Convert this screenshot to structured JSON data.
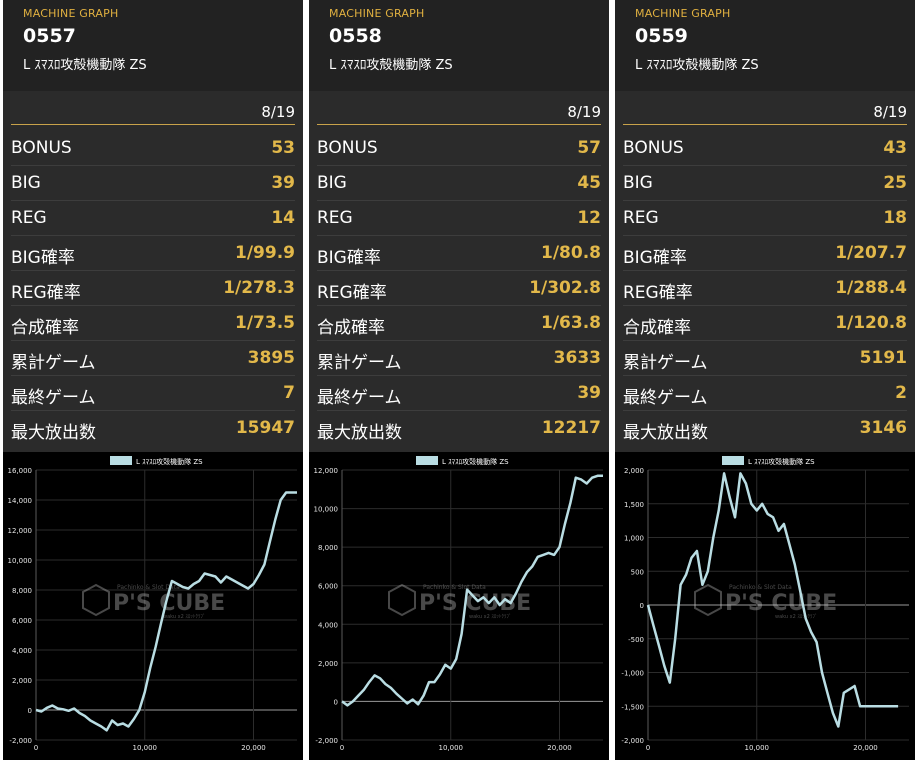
{
  "panels": [
    {
      "label": "MACHINE GRAPH",
      "number": "0557",
      "machine": "L ｽﾏｽﾛ攻殻機動隊 ZS",
      "date": "8/19",
      "stats": [
        {
          "key": "BONUS",
          "value": "53"
        },
        {
          "key": "BIG",
          "value": "39"
        },
        {
          "key": "REG",
          "value": "14"
        },
        {
          "key": "BIG確率",
          "value": "1/99.9"
        },
        {
          "key": "REG確率",
          "value": "1/278.3"
        },
        {
          "key": "合成確率",
          "value": "1/73.5"
        },
        {
          "key": "累計ゲーム",
          "value": "3895"
        },
        {
          "key": "最終ゲーム",
          "value": "7"
        },
        {
          "key": "最大放出数",
          "value": "15947"
        }
      ],
      "chart_data": {
        "type": "line",
        "series": [
          {
            "name": "L ｽﾏｽﾛ攻殻機動隊 ZS",
            "color": "#b9dde3"
          }
        ],
        "ylim": [
          -2000,
          16000
        ],
        "xlim": [
          0,
          24000
        ],
        "yticks": [
          -2000,
          0,
          2000,
          4000,
          6000,
          8000,
          10000,
          12000,
          14000,
          16000
        ],
        "ytick_labels": [
          "-2,000",
          "0",
          "2,000",
          "4,000",
          "6,000",
          "8,000",
          "10,000",
          "12,000",
          "14,000",
          "16,000"
        ],
        "xticks": [
          0,
          10000,
          20000
        ],
        "xtick_labels": [
          "0",
          "10,000",
          "20,000"
        ],
        "x": [
          0,
          500,
          1000,
          1500,
          2000,
          2500,
          3000,
          3500,
          4000,
          4500,
          5000,
          5500,
          6000,
          6500,
          7000,
          7500,
          8000,
          8500,
          9000,
          9500,
          10000,
          10500,
          11000,
          11500,
          12000,
          12500,
          13000,
          13500,
          14000,
          14500,
          15000,
          15500,
          16000,
          16500,
          17000,
          17500,
          18000,
          18500,
          19000,
          19500,
          20000,
          20500,
          21000,
          21500,
          22000,
          22500,
          23000,
          23500,
          24000
        ],
        "y": [
          0,
          -100,
          150,
          300,
          100,
          50,
          -50,
          100,
          -200,
          -400,
          -700,
          -900,
          -1100,
          -1350,
          -700,
          -1000,
          -900,
          -1100,
          -600,
          0,
          1200,
          2800,
          4200,
          5800,
          7300,
          8600,
          8400,
          8200,
          8100,
          8400,
          8600,
          9100,
          9000,
          8900,
          8500,
          8900,
          8700,
          8500,
          8300,
          8100,
          8400,
          9000,
          9700,
          11200,
          12700,
          14000,
          14500,
          14500,
          14500
        ]
      },
      "watermark": {
        "brand": "P'S CUBE",
        "top": "Pachinko & Slot Data",
        "bottom": "waku x2 ｽﾛｯﾄｸﾗﾌﾞ"
      }
    },
    {
      "label": "MACHINE GRAPH",
      "number": "0558",
      "machine": "L ｽﾏｽﾛ攻殻機動隊 ZS",
      "date": "8/19",
      "stats": [
        {
          "key": "BONUS",
          "value": "57"
        },
        {
          "key": "BIG",
          "value": "45"
        },
        {
          "key": "REG",
          "value": "12"
        },
        {
          "key": "BIG確率",
          "value": "1/80.8"
        },
        {
          "key": "REG確率",
          "value": "1/302.8"
        },
        {
          "key": "合成確率",
          "value": "1/63.8"
        },
        {
          "key": "累計ゲーム",
          "value": "3633"
        },
        {
          "key": "最終ゲーム",
          "value": "39"
        },
        {
          "key": "最大放出数",
          "value": "12217"
        }
      ],
      "chart_data": {
        "type": "line",
        "series": [
          {
            "name": "L ｽﾏｽﾛ攻殻機動隊 ZS",
            "color": "#b9dde3"
          }
        ],
        "ylim": [
          -2000,
          12000
        ],
        "xlim": [
          0,
          24000
        ],
        "yticks": [
          -2000,
          0,
          2000,
          4000,
          6000,
          8000,
          10000,
          12000
        ],
        "ytick_labels": [
          "-2,000",
          "0",
          "2,000",
          "4,000",
          "6,000",
          "8,000",
          "10,000",
          "12,000"
        ],
        "xticks": [
          0,
          10000,
          20000
        ],
        "xtick_labels": [
          "0",
          "10,000",
          "20,000"
        ],
        "x": [
          0,
          500,
          1000,
          1500,
          2000,
          2500,
          3000,
          3500,
          4000,
          4500,
          5000,
          5500,
          6000,
          6500,
          7000,
          7500,
          8000,
          8500,
          9000,
          9500,
          10000,
          10500,
          11000,
          11500,
          12000,
          12500,
          13000,
          13500,
          14000,
          14500,
          15000,
          15500,
          16000,
          16500,
          17000,
          17500,
          18000,
          18500,
          19000,
          19500,
          20000,
          20500,
          21000,
          21500,
          22000,
          22500,
          23000,
          23500,
          24000
        ],
        "y": [
          0,
          -200,
          0,
          300,
          600,
          1000,
          1350,
          1200,
          900,
          700,
          400,
          150,
          -100,
          100,
          -150,
          300,
          1000,
          1000,
          1400,
          1900,
          1700,
          2200,
          3500,
          5800,
          5500,
          5200,
          5400,
          5100,
          5400,
          5000,
          5300,
          5100,
          5600,
          6200,
          6700,
          7000,
          7500,
          7600,
          7700,
          7600,
          8000,
          9200,
          10300,
          11600,
          11500,
          11300,
          11600,
          11700,
          11700
        ]
      },
      "watermark": {
        "brand": "P'S CUBE",
        "top": "Pachinko & Slot Data",
        "bottom": "waku x2 ｽﾛｯﾄｸﾗﾌﾞ"
      }
    },
    {
      "label": "MACHINE GRAPH",
      "number": "0559",
      "machine": "L ｽﾏｽﾛ攻殻機動隊 ZS",
      "date": "8/19",
      "stats": [
        {
          "key": "BONUS",
          "value": "43"
        },
        {
          "key": "BIG",
          "value": "25"
        },
        {
          "key": "REG",
          "value": "18"
        },
        {
          "key": "BIG確率",
          "value": "1/207.7"
        },
        {
          "key": "REG確率",
          "value": "1/288.4"
        },
        {
          "key": "合成確率",
          "value": "1/120.8"
        },
        {
          "key": "累計ゲーム",
          "value": "5191"
        },
        {
          "key": "最終ゲーム",
          "value": "2"
        },
        {
          "key": "最大放出数",
          "value": "3146"
        }
      ],
      "chart_data": {
        "type": "line",
        "series": [
          {
            "name": "L ｽﾏｽﾛ攻殻機動隊 ZS",
            "color": "#b9dde3"
          }
        ],
        "ylim": [
          -2000,
          2000
        ],
        "xlim": [
          0,
          24000
        ],
        "yticks": [
          -2000,
          -1500,
          -1000,
          -500,
          0,
          500,
          1000,
          1500,
          2000
        ],
        "ytick_labels": [
          "-2,000",
          "-1,500",
          "-1,000",
          "-500",
          "0",
          "500",
          "1,000",
          "1,500",
          "2,000"
        ],
        "xticks": [
          0,
          10000,
          20000
        ],
        "xtick_labels": [
          "0",
          "10,000",
          "20,000"
        ],
        "x": [
          0,
          500,
          1000,
          1500,
          2000,
          2500,
          3000,
          3500,
          4000,
          4500,
          5000,
          5500,
          6000,
          6500,
          7000,
          7500,
          8000,
          8500,
          9000,
          9500,
          10000,
          10500,
          11000,
          11500,
          12000,
          12500,
          13000,
          13500,
          14000,
          14500,
          15000,
          15500,
          16000,
          16500,
          17000,
          17500,
          18000,
          18500,
          19000,
          19500,
          20000,
          20500,
          21000,
          21500,
          22000,
          22500,
          23000
        ],
        "y": [
          0,
          -300,
          -600,
          -900,
          -1150,
          -500,
          300,
          450,
          700,
          800,
          300,
          500,
          1000,
          1400,
          1950,
          1600,
          1300,
          1950,
          1800,
          1500,
          1400,
          1500,
          1350,
          1300,
          1100,
          1200,
          900,
          600,
          200,
          -200,
          -400,
          -550,
          -1000,
          -1300,
          -1600,
          -1800,
          -1300,
          -1250,
          -1200,
          -1500,
          -1500,
          -1500,
          -1500,
          -1500,
          -1500,
          -1500,
          -1500
        ]
      },
      "watermark": {
        "brand": "P'S CUBE",
        "top": "Pachinko & Slot Data",
        "bottom": "waku x2 ｽﾛｯﾄｸﾗﾌﾞ"
      }
    }
  ]
}
